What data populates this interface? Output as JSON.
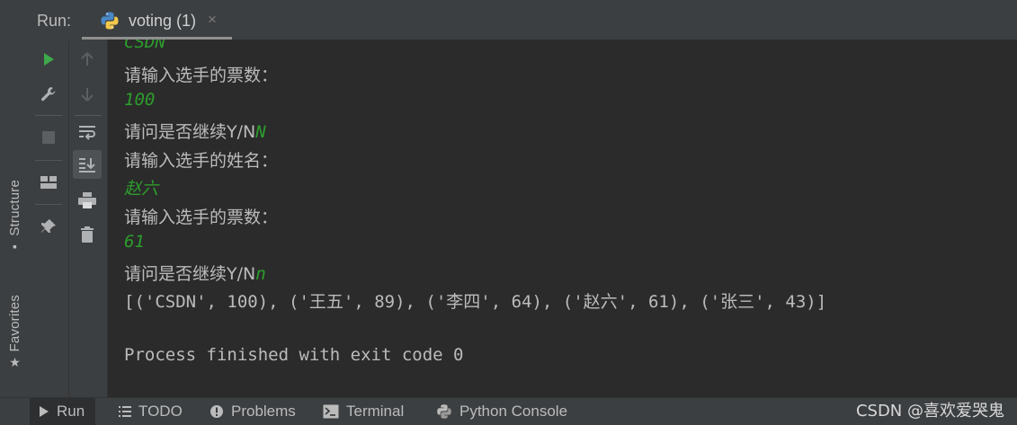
{
  "header": {
    "run_label": "Run:",
    "tab_title": "voting (1)",
    "close_symbol": "×"
  },
  "side_tabs": {
    "structure": "Structure",
    "favorites": "Favorites"
  },
  "console": {
    "lines": [
      {
        "text": "CSDN",
        "kind": "input"
      },
      {
        "text": "请输入选手的票数：",
        "kind": "prompt"
      },
      {
        "text": "100",
        "kind": "input"
      },
      {
        "prompt": "请问是否继续Y/N",
        "input": "N"
      },
      {
        "text": "请输入选手的姓名：",
        "kind": "prompt"
      },
      {
        "text": "赵六",
        "kind": "input"
      },
      {
        "text": "请输入选手的票数：",
        "kind": "prompt"
      },
      {
        "text": "61",
        "kind": "input"
      },
      {
        "prompt": "请问是否继续Y/N",
        "input": "n"
      },
      {
        "text": "[('CSDN', 100), ('王五', 89), ('李四', 64), ('赵六', 61), ('张三', 43)]",
        "kind": "output"
      },
      {
        "text": "Process finished with exit code 0",
        "kind": "output"
      }
    ]
  },
  "bottom_tabs": {
    "run": "Run",
    "todo": "TODO",
    "problems": "Problems",
    "terminal": "Terminal",
    "python_console": "Python Console"
  },
  "watermark": "CSDN @喜欢爱哭鬼",
  "colors": {
    "background": "#2b2b2b",
    "panel": "#3c3f41",
    "input_text": "#2d9d2d",
    "run_green": "#3ea84a"
  }
}
